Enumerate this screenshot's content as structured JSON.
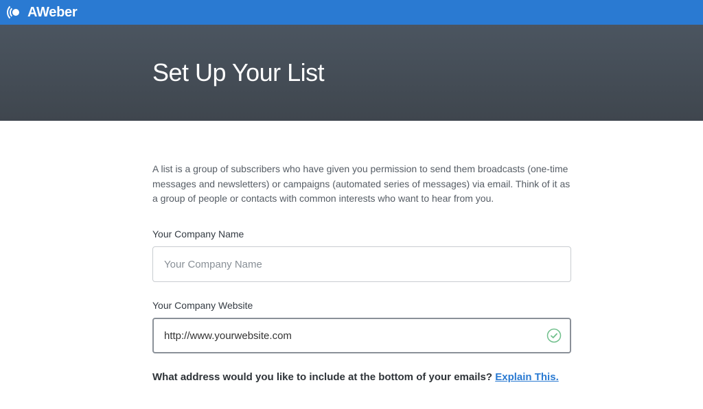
{
  "brand": {
    "name": "AWeber"
  },
  "hero": {
    "title": "Set Up Your List"
  },
  "intro": {
    "text": "A list is a group of subscribers who have given you permission to send them broadcasts (one-time messages and newsletters) or campaigns (automated series of messages) via email. Think of it as a group of people or contacts with common interests who want to hear from you."
  },
  "form": {
    "companyName": {
      "label": "Your Company Name",
      "placeholder": "Your Company Name",
      "value": ""
    },
    "companyWebsite": {
      "label": "Your Company Website",
      "value": "http://www.yourwebsite.com"
    },
    "addressQuestion": {
      "text": "What address would you like to include at the bottom of your emails? ",
      "linkText": "Explain This."
    }
  }
}
